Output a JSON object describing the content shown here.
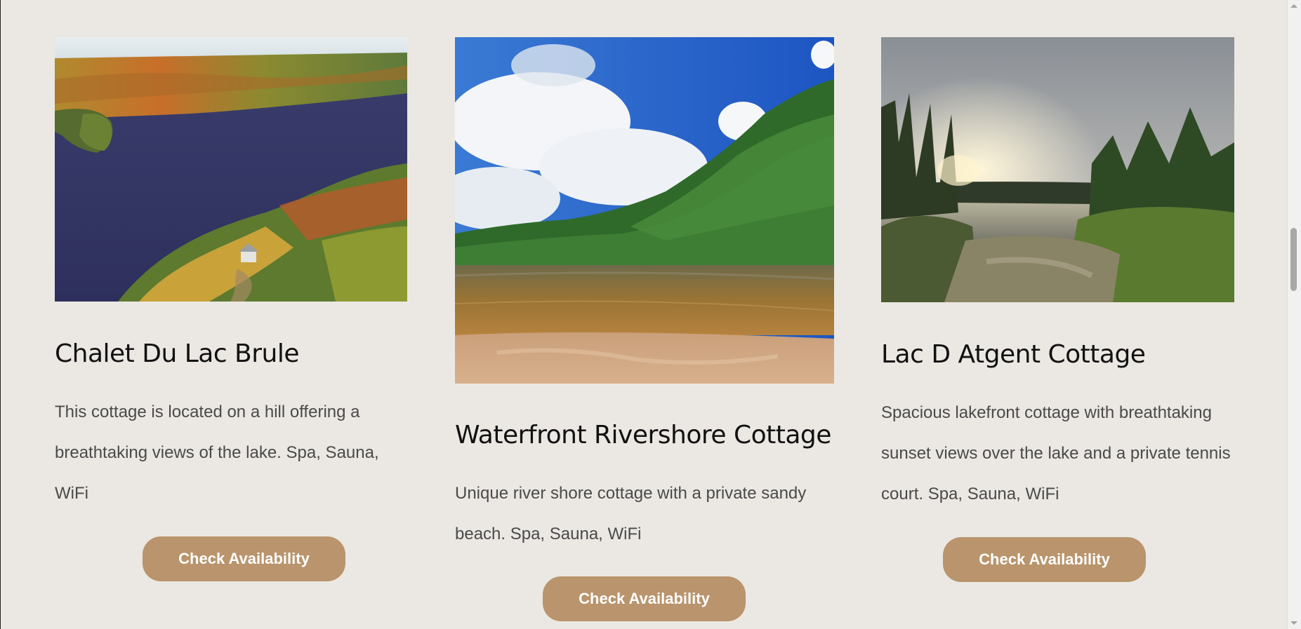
{
  "cards": [
    {
      "title": "Chalet Du Lac Brule",
      "description": "This cottage is located on a hill offering a breathtaking views of the lake. Spa, Sauna, WiFi",
      "button_label": "Check Availability",
      "image_alt": "Aerial view of autumn forest and lake"
    },
    {
      "title": "Waterfront Rivershore Cottage",
      "description": "Unique river shore cottage with a private sandy beach. Spa, Sauna, WiFi",
      "button_label": "Check Availability",
      "image_alt": "River with sandy beach and green forest"
    },
    {
      "title": "Lac D Atgent Cottage",
      "description": "Spacious lakefront cottage with breathtaking sunset views over the lake and a private tennis court. Spa, Sauna, WiFi",
      "button_label": "Check Availability",
      "image_alt": "Sunset over lake with pine trees"
    }
  ],
  "colors": {
    "background": "#ebe8e3",
    "button": "#b9946c",
    "button_text": "#ffffff",
    "title": "#111111",
    "body_text": "#4a4a4a"
  }
}
